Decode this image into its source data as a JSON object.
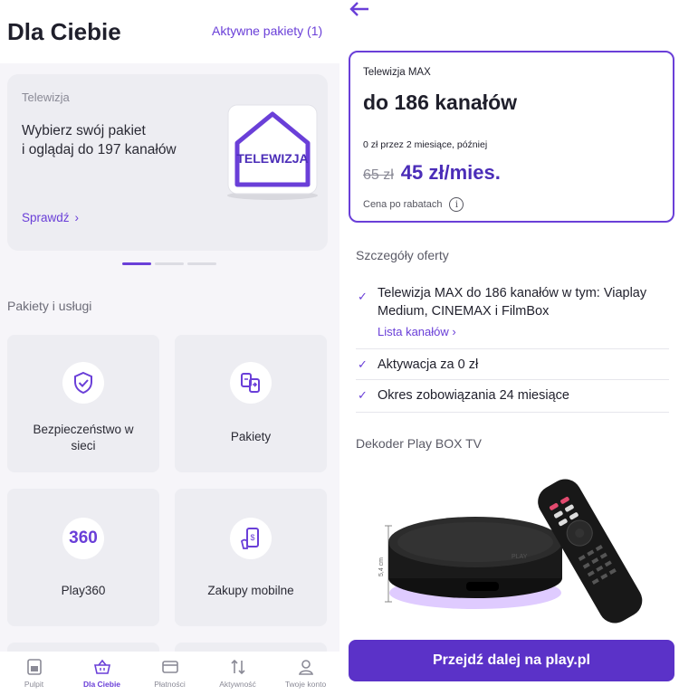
{
  "left": {
    "header": {
      "title": "Dla Ciebie",
      "active_packages": "Aktywne pakiety (1)"
    },
    "promo": {
      "tag": "Telewizja",
      "text": "Wybierz swój pakiet\ni oglądaj do 197 kanałów",
      "cta": "Sprawdź",
      "badge": "TELEWIZJA"
    },
    "section_label": "Pakiety i usługi",
    "tiles": [
      {
        "label": "Bezpieczeństwo w\nsieci",
        "icon": "shield-check-icon"
      },
      {
        "label": "Pakiety",
        "icon": "package-swap-icon"
      },
      {
        "label": "Play360",
        "icon": "play360-icon",
        "icon_text": "360"
      },
      {
        "label": "Zakupy mobilne",
        "icon": "mobile-payment-icon"
      }
    ],
    "bottom_nav": [
      {
        "label": "Pulpit",
        "icon": "dashboard-icon"
      },
      {
        "label": "Dla Ciebie",
        "icon": "basket-icon",
        "active": true
      },
      {
        "label": "Płatności",
        "icon": "card-icon"
      },
      {
        "label": "Aktywność",
        "icon": "transfer-arrows-icon"
      },
      {
        "label": "Twoje konto",
        "icon": "user-icon"
      }
    ]
  },
  "right": {
    "offer": {
      "plan": "Telewizja MAX",
      "channels": "do 186 kanałów",
      "promo": "0 zł przez 2 miesiące, później",
      "old_price": "65 zł",
      "new_price": "45 zł/mies.",
      "note": "Cena po rabatach",
      "info_glyph": "i"
    },
    "details_title": "Szczegóły oferty",
    "details": [
      {
        "text": "Telewizja MAX do 186 kanałów w tym: Viaplay Medium, CINEMAX i FilmBox",
        "link": "Lista kanałów"
      },
      {
        "text": "Aktywacja za 0 zł"
      },
      {
        "text": "Okres zobowiązania 24 miesiące"
      }
    ],
    "decoder_title": "Dekoder Play BOX TV",
    "device": {
      "dimension_label": "5,4 cm",
      "brand": "PLAY"
    },
    "cta": "Przejdź dalej na play.pl"
  },
  "colors": {
    "accent": "#6a3fd8",
    "cta": "#5b32c8",
    "price": "#4b2db8"
  }
}
